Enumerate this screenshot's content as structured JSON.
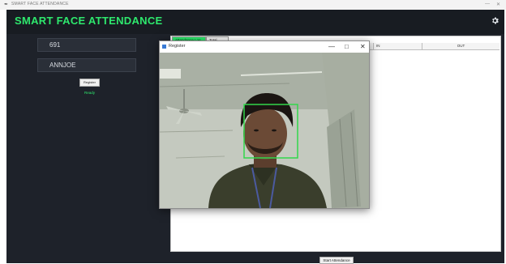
{
  "os_window": {
    "title": "SMART FACE ATTENDANCE",
    "minimize_glyph": "—",
    "close_glyph": "✕"
  },
  "header": {
    "title": "SMART FACE ATTENDANCE",
    "title_color": "#2ee86d",
    "settings_icon": "gear-icon"
  },
  "form": {
    "id_value": "691",
    "name_value": "ANNJOE",
    "register_label": "Register",
    "status": "Ready"
  },
  "attendance": {
    "tabs": [
      {
        "label": "Attendance Log",
        "active": true
      },
      {
        "label": "Total Time",
        "active": false
      }
    ],
    "columns": [
      "IN",
      "OUT"
    ],
    "start_label": "Start Attendance"
  },
  "register_window": {
    "title": "Register",
    "minimize_glyph": "—",
    "maximize_glyph": "□",
    "close_glyph": "✕",
    "face_box_color": "#32d74b"
  }
}
